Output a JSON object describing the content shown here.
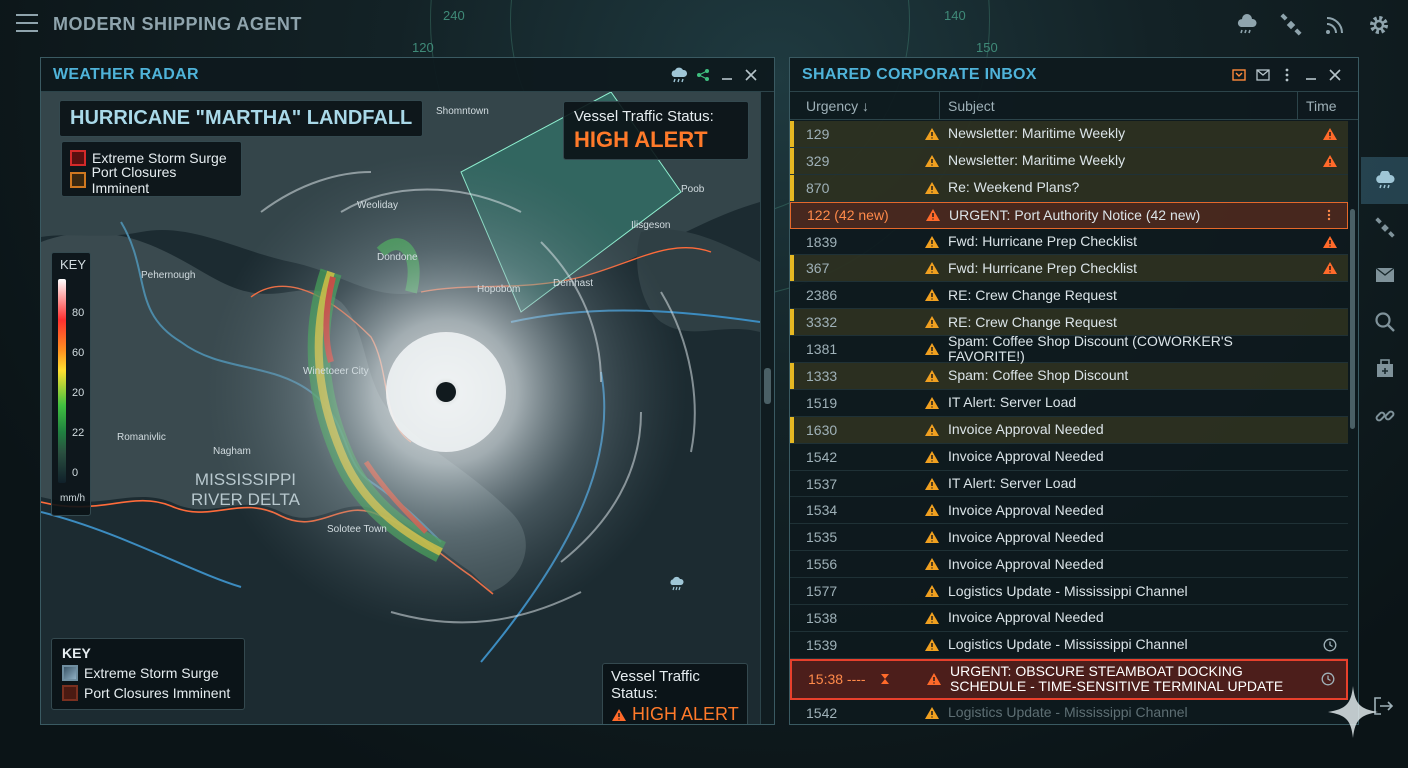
{
  "app": {
    "title": "MODERN SHIPPING AGENT"
  },
  "background": {
    "bearing_labels": [
      "240",
      "120",
      "140",
      "150"
    ]
  },
  "top_icons": [
    "weather-icon",
    "satellite-icon",
    "signal-icon",
    "gear-icon"
  ],
  "radar": {
    "panel_title": "WEATHER RADAR",
    "map_title": "HURRICANE \"MARTHA\" LANDFALL",
    "legend_top": [
      {
        "label": "Extreme Storm Surge",
        "color": "#d42a2a"
      },
      {
        "label": "Port Closures Imminent",
        "color": "#d07820"
      }
    ],
    "vessel_top": {
      "label": "Vessel Traffic Status:",
      "status": "HIGH ALERT"
    },
    "scale": {
      "title": "KEY",
      "ticks": [
        "80",
        "60",
        "20",
        "22",
        "0"
      ],
      "unit": "mm/h"
    },
    "places": [
      "Shomntown",
      "Weoliday",
      "Dondone",
      "Pehernough",
      "Hopobom",
      "Demhast",
      "Winetoeer City",
      "Romanivlic",
      "Nagham",
      "Solotee Town",
      "Ilisgeson",
      "Poob"
    ],
    "region": {
      "line1": "MISSISSIPPI",
      "line2": "RIVER DELTA"
    },
    "legend_bottom": {
      "title": "KEY",
      "items": [
        {
          "label": "Extreme Storm Surge",
          "color": "#6f8ea0"
        },
        {
          "label": "Port Closures Imminent",
          "color": "#7a3020"
        }
      ]
    },
    "vessel_bottom": {
      "label": "Vessel Traffic Status:",
      "status": "HIGH ALERT"
    }
  },
  "inbox": {
    "panel_title": "SHARED CORPORATE INBOX",
    "columns": {
      "urgency": "Urgency ↓",
      "subject": "Subject",
      "time": "Time"
    },
    "rows": [
      {
        "urgency": "129",
        "subject": "Newsletter: Maritime Weekly",
        "style": "hl",
        "time_icon": "warning"
      },
      {
        "urgency": "329",
        "subject": "Newsletter: Maritime Weekly",
        "style": "hl",
        "time_icon": "warning"
      },
      {
        "urgency": "870",
        "subject": "Re: Weekend Plans?",
        "style": "hl",
        "time_icon": ""
      },
      {
        "urgency": "122 (42 new)",
        "subject": "URGENT: Port Authority Notice (42 new)",
        "style": "urgent",
        "time_icon": "more"
      },
      {
        "urgency": "1839",
        "subject": "Fwd: Hurricane Prep Checklist",
        "style": "",
        "time_icon": "warning"
      },
      {
        "urgency": "367",
        "subject": "Fwd: Hurricane Prep Checklist",
        "style": "hl",
        "time_icon": "warning"
      },
      {
        "urgency": "2386",
        "subject": "RE: Crew Change Request",
        "style": "",
        "time_icon": ""
      },
      {
        "urgency": "3332",
        "subject": "RE: Crew Change Request",
        "style": "hl",
        "time_icon": ""
      },
      {
        "urgency": "1381",
        "subject": "Spam: Coffee Shop Discount (COWORKER'S FAVORITE!)",
        "style": "",
        "time_icon": ""
      },
      {
        "urgency": "1333",
        "subject": "Spam: Coffee Shop Discount",
        "style": "hl",
        "time_icon": ""
      },
      {
        "urgency": "1519",
        "subject": "IT Alert: Server Load",
        "style": "",
        "time_icon": ""
      },
      {
        "urgency": "1630",
        "subject": "Invoice Approval Needed",
        "style": "hl",
        "time_icon": ""
      },
      {
        "urgency": "1542",
        "subject": "Invoice Approval Needed",
        "style": "",
        "time_icon": ""
      },
      {
        "urgency": "1537",
        "subject": "IT Alert: Server Load",
        "style": "",
        "time_icon": ""
      },
      {
        "urgency": "1534",
        "subject": "Invoice Approval Needed",
        "style": "",
        "time_icon": ""
      },
      {
        "urgency": "1535",
        "subject": "Invoice Approval Needed",
        "style": "",
        "time_icon": ""
      },
      {
        "urgency": "1556",
        "subject": "Invoice Approval Needed",
        "style": "",
        "time_icon": ""
      },
      {
        "urgency": "1577",
        "subject": "Logistics Update - Mississippi Channel",
        "style": "",
        "time_icon": ""
      },
      {
        "urgency": "1538",
        "subject": "Invoice Approval Needed",
        "style": "",
        "time_icon": ""
      },
      {
        "urgency": "1539",
        "subject": "Logistics Update - Mississippi Channel",
        "style": "",
        "time_icon": "clock"
      },
      {
        "urgency": "15:38 ----",
        "subject": "URGENT: OBSCURE STEAMBOAT DOCKING SCHEDULE - TIME-SENSITIVE TERMINAL UPDATE",
        "style": "critical",
        "time_icon": "clock"
      },
      {
        "urgency": "1542",
        "subject": "Logistics Update - Mississippi Channel",
        "style": "fade",
        "time_icon": ""
      }
    ]
  },
  "sidebar": {
    "items": [
      "weather-icon",
      "satellite-icon",
      "mail-icon",
      "search-icon",
      "package-icon",
      "link-icon"
    ],
    "active": 0
  },
  "colors": {
    "accent": "#4fb3d9",
    "alert": "#ff7a2a",
    "critical": "#e8402c",
    "highlight": "#e6b822"
  }
}
